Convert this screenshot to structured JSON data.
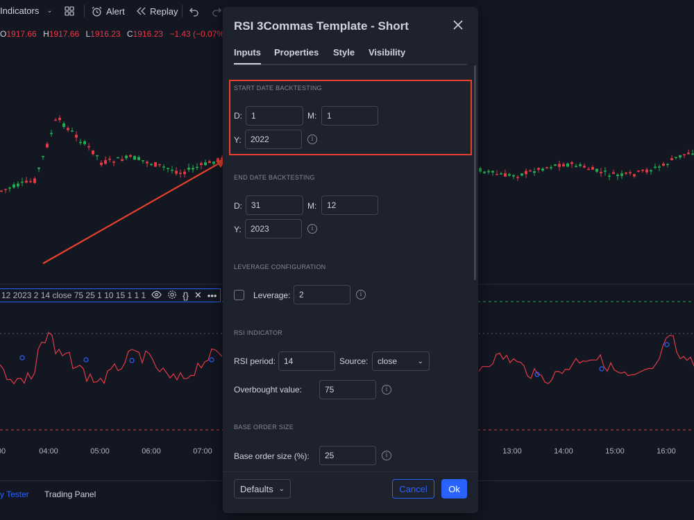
{
  "toolbar": {
    "indicators_label": "Indicators",
    "alert_label": "Alert",
    "replay_label": "Replay"
  },
  "ohlc": {
    "o_key": "O",
    "o_val": "1917.66",
    "h_key": "H",
    "h_val": "1917.66",
    "l_key": "L",
    "l_val": "1916.23",
    "c_key": "C",
    "c_val": "1916.23",
    "change": "−1.43 (−0.07%)"
  },
  "indicator_row": {
    "text": "12 2023 2 14 close 75 25 1 10 15 1 1 1"
  },
  "time_axis": [
    "00",
    "04:00",
    "05:00",
    "06:00",
    "07:00",
    "13:00",
    "14:00",
    "15:00",
    "16:00"
  ],
  "bottom_bar": {
    "strategy_tester": "y Tester",
    "trading_panel": "Trading Panel"
  },
  "dialog": {
    "title": "RSI 3Commas Template - Short",
    "tabs": [
      "Inputs",
      "Properties",
      "Style",
      "Visibility"
    ],
    "start_section": "START DATE BACKTESTING",
    "start_d_label": "D:",
    "start_d": "1",
    "start_m_label": "M:",
    "start_m": "1",
    "start_y_label": "Y:",
    "start_y": "2022",
    "end_section": "END DATE BACKTESTING",
    "end_d_label": "D:",
    "end_d": "31",
    "end_m_label": "M:",
    "end_m": "12",
    "end_y_label": "Y:",
    "end_y": "2023",
    "leverage_section": "LEVERAGE CONFIGURATION",
    "leverage_label": "Leverage:",
    "leverage": "2",
    "rsi_section": "RSI INDICATOR",
    "rsi_period_label": "RSI period:",
    "rsi_period": "14",
    "source_label": "Source:",
    "source": "close",
    "overbought_label": "Overbought value:",
    "overbought": "75",
    "base_section": "BASE ORDER SIZE",
    "base_label": "Base order size (%):",
    "base": "25",
    "defaults_label": "Defaults",
    "cancel_label": "Cancel",
    "ok_label": "Ok"
  },
  "colors": {
    "up": "#22ab4f",
    "down": "#e23b46",
    "accent": "#2962ff",
    "highlight": "#e8412c",
    "rsi_line": "#e23b46",
    "overbought_line": "#22ab4f"
  }
}
